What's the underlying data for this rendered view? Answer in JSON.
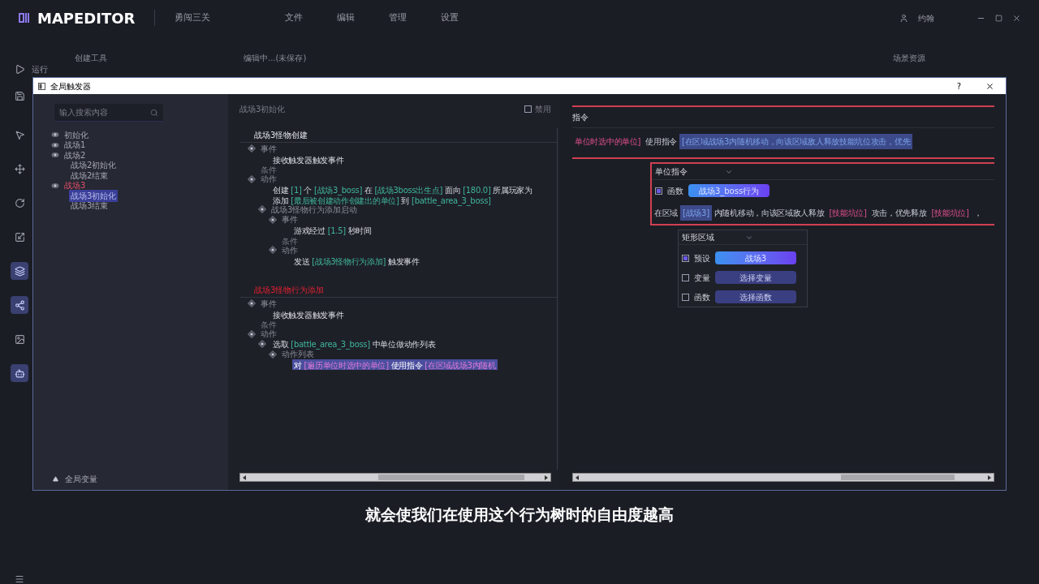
{
  "app": {
    "logo": "MAPEDITOR",
    "project": "勇闯三关",
    "menu": [
      "文件",
      "编辑",
      "管理",
      "设置"
    ],
    "user": "约翰",
    "run_label": "运行",
    "panels": [
      "创建工具",
      "编辑中...(未保存)",
      "场景资源"
    ]
  },
  "tools": [
    {
      "kind": "cursor",
      "selected": false
    },
    {
      "kind": "move",
      "selected": false
    },
    {
      "kind": "rotate",
      "selected": false
    },
    {
      "kind": "scale",
      "selected": false
    },
    {
      "kind": "layers",
      "selected": true
    },
    {
      "kind": "nodes",
      "selected": true
    },
    {
      "kind": "image",
      "selected": false
    },
    {
      "kind": "robot",
      "selected": true
    }
  ],
  "dialog": {
    "title": "全局触发器",
    "help": "?",
    "search_placeholder": "输入搜索内容",
    "tree": [
      {
        "label": "初始化",
        "selected": false,
        "error": false
      },
      {
        "label": "战场1",
        "selected": false,
        "error": false
      },
      {
        "label": "战场2",
        "selected": false,
        "error": false,
        "children": [
          {
            "label": "战场2初始化",
            "selected": false,
            "error": false
          },
          {
            "label": "战场2结束",
            "selected": false,
            "error": false
          }
        ]
      },
      {
        "label": "战场3",
        "selected": false,
        "error": true,
        "children": [
          {
            "label": "战场3初始化",
            "selected": true,
            "error": false
          },
          {
            "label": "战场3结束",
            "selected": false,
            "error": false
          }
        ]
      }
    ],
    "footer": "全局变量",
    "editor": {
      "title": "战场3初始化",
      "disable_label": "禁用",
      "disabled": false,
      "triggers": [
        {
          "title": "战场3怪物创建",
          "error": false,
          "nodes": [
            {
              "kind": "section",
              "label": "事件",
              "children": [
                {
                  "kind": "line",
                  "text": "接收触发器触发事件",
                  "selected": false
                }
              ]
            },
            {
              "kind": "label",
              "label": "条件"
            },
            {
              "kind": "section",
              "label": "动作",
              "children": [
                {
                  "kind": "line",
                  "text": "创建 [1] 个 [战场3_boss] 在 [战场3boss出生点] 面向 [180.0] 所属玩家为",
                  "selected": false
                },
                {
                  "kind": "line",
                  "text": "添加 [最后被创建动作创建出的单位] 到 [battle_area_3_boss]",
                  "selected": false
                },
                {
                  "kind": "section",
                  "label": "战场3怪物行为添加启动",
                  "children": [
                    {
                      "kind": "section",
                      "label": "事件",
                      "children": [
                        {
                          "kind": "line",
                          "text": "游戏经过 [1.5] 秒时间",
                          "selected": false
                        }
                      ]
                    },
                    {
                      "kind": "label",
                      "label": "条件"
                    },
                    {
                      "kind": "section",
                      "label": "动作",
                      "children": [
                        {
                          "kind": "line",
                          "text": "发送 [战场3怪物行为添加] 触发事件",
                          "selected": false
                        }
                      ]
                    }
                  ]
                }
              ]
            }
          ]
        },
        {
          "title": "战场3怪物行为添加",
          "error": true,
          "nodes": [
            {
              "kind": "section",
              "label": "事件",
              "children": [
                {
                  "kind": "line",
                  "text": "接收触发器触发事件",
                  "selected": false
                }
              ]
            },
            {
              "kind": "label",
              "label": "条件"
            },
            {
              "kind": "section",
              "label": "动作",
              "children": [
                {
                  "kind": "block",
                  "text": "选取 [battle_area_3_boss] 中单位做动作列表",
                  "children": [
                    {
                      "kind": "section",
                      "label": "动作列表",
                      "children": [
                        {
                          "kind": "line",
                          "text": "对 [遍历单位时选中的单位] 使用指令 [在区域战场3内随机",
                          "selected": true
                        }
                      ]
                    }
                  ]
                }
              ]
            }
          ]
        }
      ]
    },
    "command": {
      "header": "指令",
      "usage": [
        {
          "kind": "param",
          "text": "单位时选中的单位]",
          "selected": false
        },
        {
          "kind": "text",
          "text": "使用指令",
          "selected": false
        },
        {
          "kind": "param",
          "text": "[在区域战场3内随机移动，向该区域敌人释放技能坑位攻击，优先",
          "selected": true
        }
      ],
      "dropdown": "单位指令",
      "source": {
        "checked": true,
        "label": "函数",
        "button": "战场3_boss行为"
      },
      "sentence": [
        {
          "kind": "text",
          "text": "在区域",
          "selected": false
        },
        {
          "kind": "param",
          "text": "[战场3]",
          "selected": true
        },
        {
          "kind": "text",
          "text": "内随机移动，向该区域敌人释放",
          "selected": false
        },
        {
          "kind": "param",
          "text": "[技能坑位]",
          "selected": false
        },
        {
          "kind": "text",
          "text": "攻击，优先释放",
          "selected": false
        },
        {
          "kind": "param",
          "text": "[技能坑位]",
          "selected": false
        },
        {
          "kind": "text",
          "text": "，",
          "selected": false
        }
      ],
      "area": {
        "dropdown": "矩形区域",
        "options": [
          {
            "label": "预设",
            "checked": true,
            "button": "战场3"
          },
          {
            "label": "变量",
            "checked": false,
            "button": "选择变量"
          },
          {
            "label": "函数",
            "checked": false,
            "button": "选择函数"
          }
        ]
      }
    }
  },
  "subtitle": "就会使我们在使用这个行为树时的自由度越高"
}
